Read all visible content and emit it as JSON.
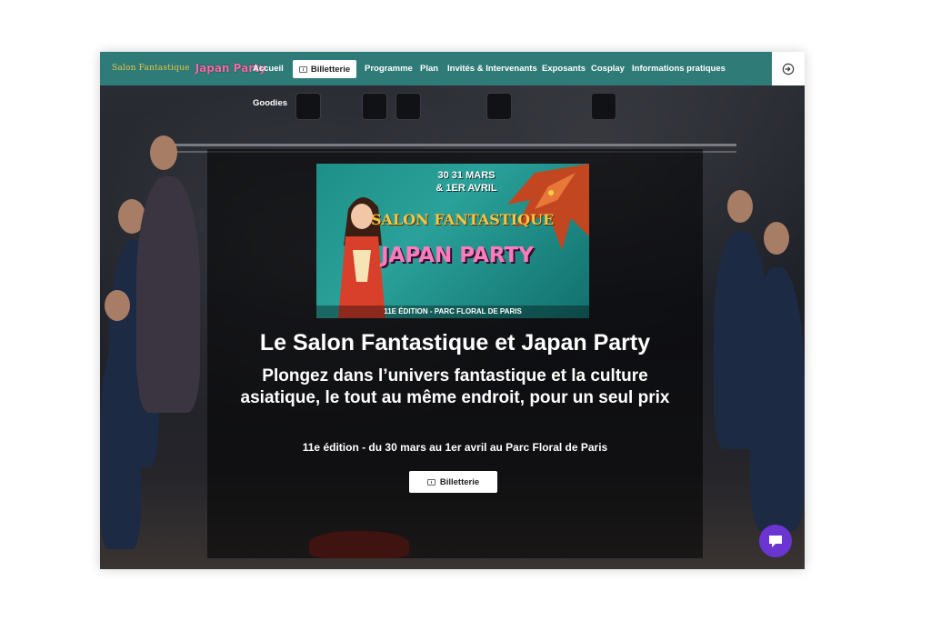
{
  "header": {
    "logo_salon": "Salon Fantastique",
    "logo_japan": "Japan Party",
    "nav": {
      "accueil": "Accueil",
      "billetterie": "Billetterie",
      "programme": "Programme",
      "plan": "Plan",
      "invites": "Invités & Intervenants",
      "exposants": "Exposants",
      "cosplay": "Cosplay",
      "infos": "Informations pratiques",
      "goodies": "Goodies"
    },
    "login_icon": "login-icon"
  },
  "poster": {
    "dates_line1": "30 31 MARS",
    "dates_line2": "& 1ER AVRIL",
    "salon": "SALON FANTASTIQUE",
    "japan": "JAPAN PARTY",
    "bottom": "11E ÉDITION - PARC FLORAL DE PARIS"
  },
  "hero": {
    "title": "Le Salon Fantastique et Japan Party",
    "subtitle": "Plongez dans l’univers fantastique et la culture asiatique, le tout au même endroit, pour un seul prix",
    "edition": "11e édition - du 30 mars au 1er avril au Parc Floral de Paris",
    "button": "Billetterie"
  },
  "colors": {
    "header": "#2f7b78",
    "chat": "#6a35d1"
  }
}
